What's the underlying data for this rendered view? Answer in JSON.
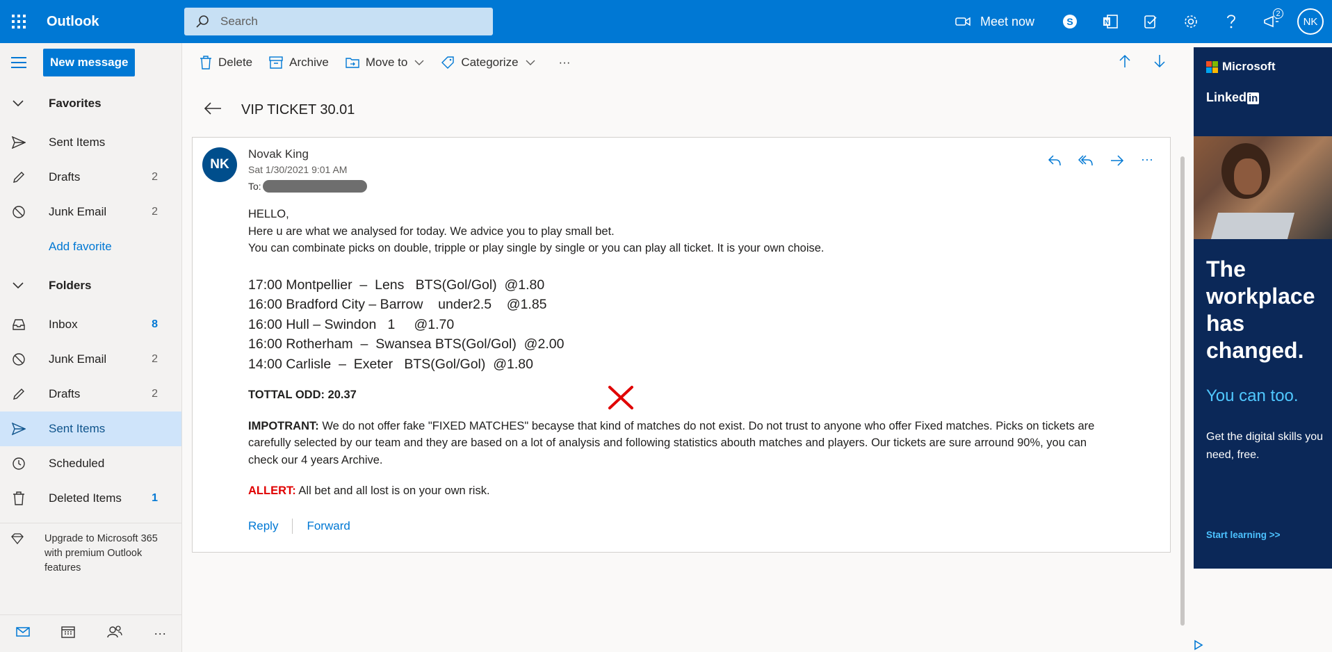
{
  "app": {
    "name": "Outlook",
    "search_placeholder": "Search",
    "meet_now": "Meet now",
    "notifications_count": "2",
    "user_initials": "NK"
  },
  "nav": {
    "new_message": "New message",
    "favorites_label": "Favorites",
    "favorites": [
      {
        "label": "Sent Items",
        "count": ""
      },
      {
        "label": "Drafts",
        "count": "2"
      },
      {
        "label": "Junk Email",
        "count": "2"
      }
    ],
    "add_favorite": "Add favorite",
    "folders_label": "Folders",
    "folders": [
      {
        "label": "Inbox",
        "count": "8"
      },
      {
        "label": "Junk Email",
        "count": "2"
      },
      {
        "label": "Drafts",
        "count": "2"
      },
      {
        "label": "Sent Items",
        "count": ""
      },
      {
        "label": "Scheduled",
        "count": ""
      },
      {
        "label": "Deleted Items",
        "count": "1"
      }
    ],
    "upgrade": "Upgrade to Microsoft 365 with premium Outlook features"
  },
  "commands": {
    "delete": "Delete",
    "archive": "Archive",
    "move_to": "Move to",
    "categorize": "Categorize",
    "more": "···"
  },
  "message": {
    "subject": "VIP TICKET 30.01",
    "sender_initials": "NK",
    "sender_name": "Novak King",
    "date": "Sat 1/30/2021 9:01 AM",
    "to_label": "To:",
    "greeting": "HELLO,",
    "line1": "Here u are what we analysed for today. We advice you to play small bet.",
    "line2": "You can combinate picks on double, tripple or play single by single or you can play all ticket. It is your own choise.",
    "picks": [
      "17:00 Montpellier  –  Lens   BTS(Gol/Gol)  @1.80",
      "16:00 Bradford City – Barrow    under2.5    @1.85",
      "16:00 Hull – Swindon   1     @1.70",
      "16:00 Rotherham  –  Swansea BTS(Gol/Gol)  @2.00",
      "14:00 Carlisle  –  Exeter   BTS(Gol/Gol)  @1.80"
    ],
    "total_odd": "TOTTAL ODD: 20.37",
    "important_label": "IMPOTRANT:",
    "important_text": " We do not offer fake \"FIXED MATCHES\" becayse that kind of matches do not exist. Do not trust to anyone who offer Fixed matches. Picks on tickets are carefully selected by our team and they are based on a lot of analysis and following statistics abouth matches and players. Our tickets are sure arround 90%, you can check our 4 years Archive.",
    "allert_label": "ALLERT:",
    "allert_text": " All bet and all lost is on your own risk.",
    "reply": "Reply",
    "forward": "Forward"
  },
  "ad": {
    "microsoft": "Microsoft",
    "linkedin": "Linked",
    "linkedin_in": "in",
    "headline": "The workplace has changed.",
    "sub": "You can too.",
    "copy": "Get the digital skills you need, free.",
    "cta": "Start learning >>"
  },
  "colors": {
    "brand_blue": "#0078d4",
    "selected_bg": "#cfe4fa",
    "alert_red": "#e00000"
  }
}
